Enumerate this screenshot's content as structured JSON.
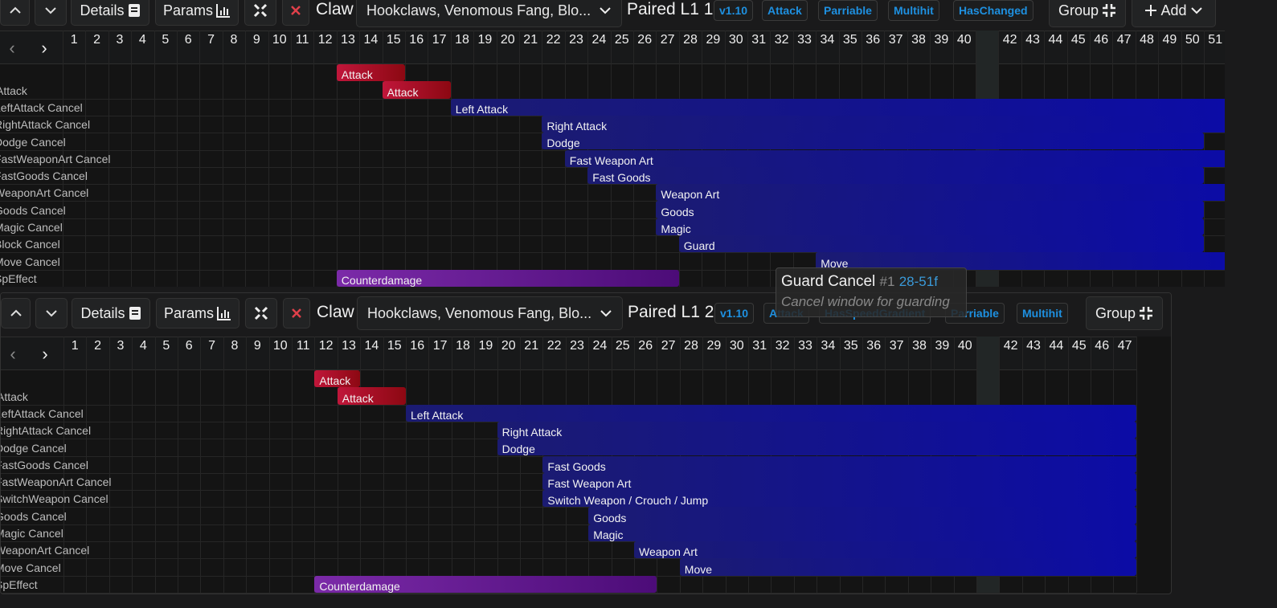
{
  "colors": {
    "attack": "#b3142c",
    "cancel": "#16167a",
    "speffect": "#7b2aa8",
    "tag_text": "#1e90e0",
    "highlight_col": "#222626"
  },
  "icons": {
    "up": "chevron-up-icon",
    "down": "chevron-down-icon",
    "details": "book-icon",
    "params": "bar-chart-icon",
    "compress": "compress-icon",
    "close": "close-x-icon",
    "group": "collapse-icon",
    "add": "plus-icon",
    "prev": "chevron-left-icon",
    "next": "chevron-right-icon"
  },
  "panels": [
    {
      "toolbar": {
        "details_label": "Details",
        "params_label": "Params",
        "category": "Claw",
        "weapon_select": "Hookclaws, Venomous Fang, Blo...",
        "anim_title": "Paired L1 1",
        "tags": [
          "v1.10",
          "Attack",
          "Parriable",
          "Multihit",
          "HasChanged"
        ],
        "group_label": "Group",
        "add_label": "Add"
      },
      "frame_count": 51,
      "highlighted_frame": 41,
      "rows": [
        {
          "label": "Attack",
          "bars": [
            {
              "label": "Attack",
              "start": 13,
              "end": 15,
              "type": "attack"
            },
            {
              "label": "Attack",
              "start": 15,
              "end": 17,
              "type": "attack"
            }
          ]
        },
        {
          "label": "LeftAttack Cancel",
          "bars": [
            {
              "label": "Left Attack",
              "start": 18,
              "end": 51,
              "type": "cancel"
            }
          ]
        },
        {
          "label": "RightAttack Cancel",
          "bars": [
            {
              "label": "Right Attack",
              "start": 22,
              "end": 51,
              "type": "cancel"
            }
          ]
        },
        {
          "label": "Dodge Cancel",
          "bars": [
            {
              "label": "Dodge",
              "start": 22,
              "end": 50,
              "type": "cancel"
            }
          ]
        },
        {
          "label": "FastWeaponArt Cancel",
          "bars": [
            {
              "label": "Fast Weapon Art",
              "start": 23,
              "end": 51,
              "type": "cancel"
            }
          ]
        },
        {
          "label": "FastGoods Cancel",
          "bars": [
            {
              "label": "Fast Goods",
              "start": 24,
              "end": 50,
              "type": "cancel"
            }
          ]
        },
        {
          "label": "WeaponArt Cancel",
          "bars": [
            {
              "label": "Weapon Art",
              "start": 27,
              "end": 51,
              "type": "cancel"
            }
          ]
        },
        {
          "label": "Goods Cancel",
          "bars": [
            {
              "label": "Goods",
              "start": 27,
              "end": 50,
              "type": "cancel"
            }
          ]
        },
        {
          "label": "Magic Cancel",
          "bars": [
            {
              "label": "Magic",
              "start": 27,
              "end": 50,
              "type": "cancel"
            }
          ]
        },
        {
          "label": "Block Cancel",
          "bars": [
            {
              "label": "Guard",
              "start": 28,
              "end": 50,
              "type": "cancel"
            }
          ]
        },
        {
          "label": "Move Cancel",
          "bars": [
            {
              "label": "Move",
              "start": 34,
              "end": 51,
              "type": "cancel"
            }
          ]
        },
        {
          "label": "SpEffect",
          "bars": [
            {
              "label": "Counterdamage",
              "start": 13,
              "end": 27,
              "type": "speffect"
            }
          ]
        }
      ]
    },
    {
      "toolbar": {
        "details_label": "Details",
        "params_label": "Params",
        "category": "Claw",
        "weapon_select": "Hookclaws, Venomous Fang, Blo...",
        "anim_title": "Paired L1 2",
        "tags": [
          "v1.10",
          "Attack",
          "HasSpeedGradient",
          "Parriable",
          "Multihit"
        ],
        "group_label": "Group"
      },
      "frame_count": 47,
      "highlighted_frame": 41,
      "rows": [
        {
          "label": "Attack",
          "bars": [
            {
              "label": "Attack",
              "start": 12,
              "end": 13,
              "type": "attack"
            },
            {
              "label": "Attack",
              "start": 13,
              "end": 15,
              "type": "attack"
            }
          ]
        },
        {
          "label": "LeftAttack Cancel",
          "bars": [
            {
              "label": "Left Attack",
              "start": 16,
              "end": 47,
              "type": "cancel"
            }
          ]
        },
        {
          "label": "RightAttack Cancel",
          "bars": [
            {
              "label": "Right Attack",
              "start": 20,
              "end": 47,
              "type": "cancel"
            }
          ]
        },
        {
          "label": "Dodge Cancel",
          "bars": [
            {
              "label": "Dodge",
              "start": 20,
              "end": 47,
              "type": "cancel"
            }
          ]
        },
        {
          "label": "FastGoods Cancel",
          "bars": [
            {
              "label": "Fast Goods",
              "start": 22,
              "end": 47,
              "type": "cancel"
            }
          ]
        },
        {
          "label": "FastWeaponArt Cancel",
          "bars": [
            {
              "label": "Fast Weapon Art",
              "start": 22,
              "end": 47,
              "type": "cancel"
            }
          ]
        },
        {
          "label": "SwitchWeapon Cancel",
          "bars": [
            {
              "label": "Switch Weapon / Crouch / Jump",
              "start": 22,
              "end": 47,
              "type": "cancel"
            }
          ]
        },
        {
          "label": "Goods Cancel",
          "bars": [
            {
              "label": "Goods",
              "start": 24,
              "end": 47,
              "type": "cancel"
            }
          ]
        },
        {
          "label": "Magic Cancel",
          "bars": [
            {
              "label": "Magic",
              "start": 24,
              "end": 47,
              "type": "cancel"
            }
          ]
        },
        {
          "label": "WeaponArt Cancel",
          "bars": [
            {
              "label": "Weapon Art",
              "start": 26,
              "end": 47,
              "type": "cancel"
            }
          ]
        },
        {
          "label": "Move Cancel",
          "bars": [
            {
              "label": "Move",
              "start": 28,
              "end": 47,
              "type": "cancel"
            }
          ]
        },
        {
          "label": "SpEffect",
          "bars": [
            {
              "label": "Counterdamage",
              "start": 12,
              "end": 26,
              "type": "speffect"
            }
          ]
        }
      ]
    }
  ],
  "tooltip": {
    "title": "Guard Cancel",
    "index": "#1",
    "range": "28-51f",
    "description": "Cancel window for guarding"
  }
}
